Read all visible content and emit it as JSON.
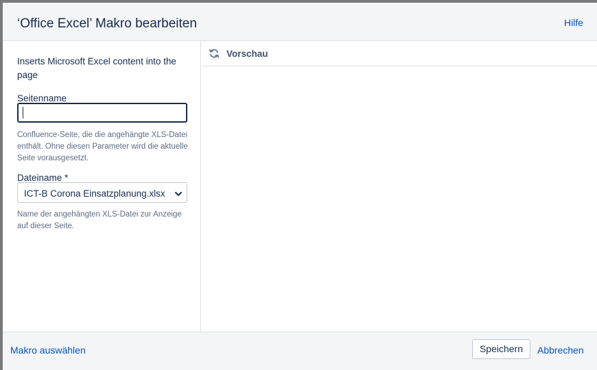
{
  "dialog": {
    "title": "‘Office Excel’ Makro bearbeiten",
    "help_label": "Hilfe"
  },
  "form": {
    "description": "Inserts Microsoft Excel content into the page",
    "page_name": {
      "label": "Seitenname",
      "value": "",
      "help": "Confluence-Seite, die die angehängte XLS-Datei enthält. Ohne diesen Parameter wird die aktuelle Seite vorausgesetzt."
    },
    "file_name": {
      "label": "Dateiname *",
      "selected": "ICT-B Corona Einsatzplanung.xlsx",
      "help": "Name der angehängten XLS-Datei zur Anzeige auf dieser Seite."
    }
  },
  "preview": {
    "label": "Vorschau",
    "refresh_icon": "refresh-icon"
  },
  "footer": {
    "select_macro_label": "Makro auswählen",
    "save_label": "Speichern",
    "cancel_label": "Abbrechen"
  }
}
